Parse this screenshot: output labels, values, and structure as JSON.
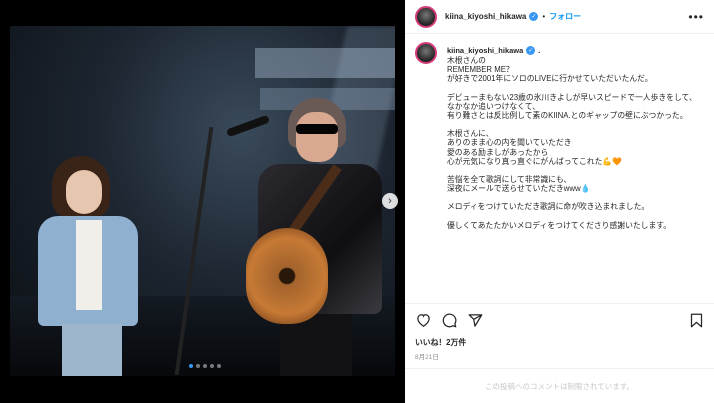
{
  "post": {
    "username": "kiina_kiyoshi_hikawa",
    "follow_label": "フォロー",
    "separator": "•",
    "more_label": "•••",
    "caption_paragraphs": [
      "木根さんの\nREMEMBER ME？\nが好きで2001年にソロのLIVEに行かせていただいたんだ。",
      "デビューまもない23歳の氷川きよしが早いスピードで一人歩きをして、\nなかなか追いつけなくて、\n有り難さとは反比例して素のKIINA.とのギャップの壁にぶつかった。",
      "木根さんに、\nありのまま心の内を聞いていただき\n愛のある励ましがあったから\n心が元気になり真っ直ぐにがんばってこれた💪🧡",
      "苦悩を全て歌詞にして非常識にも、\n深夜にメールで送らせていただきwww💧",
      "メロディをつけていただき歌詞に命が吹き込まれました。",
      "優しくてあたたかいメロディをつけてくださり感謝いたします。"
    ],
    "caption_dot": ".",
    "likes_text": "いいね！2万件",
    "date_text": "8月21日",
    "comments_off_text": "この投稿へのコメントは制限されています。",
    "carousel_arrow": "›"
  },
  "icons": [
    "heart-icon",
    "comment-icon",
    "share-icon",
    "bookmark-icon",
    "verified-badge-icon",
    "more-options-icon",
    "next-arrow-icon"
  ],
  "colors": {
    "accent_blue": "#0095f6",
    "verified_blue": "#3897f0",
    "text": "#262626",
    "muted": "#8e8e8e"
  }
}
